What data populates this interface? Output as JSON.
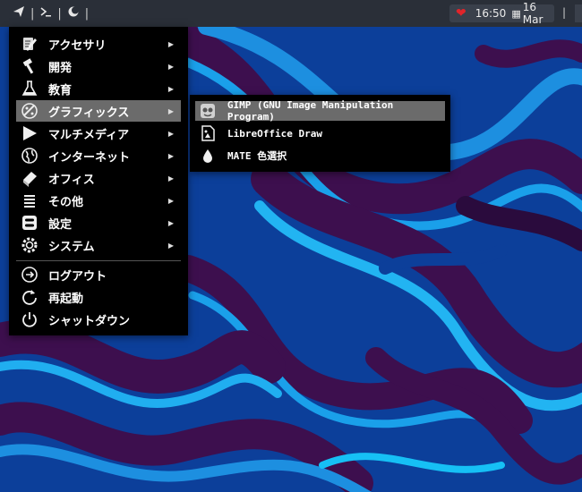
{
  "panel": {
    "icons": [
      "paper-plane-icon",
      "terminal-icon",
      "moon-icon"
    ],
    "separator": "|",
    "clock": {
      "time": "16:50",
      "date": "16 Mar"
    }
  },
  "menu": {
    "items": [
      {
        "label": "アクセサリ",
        "icon": "accessories-icon"
      },
      {
        "label": "開発",
        "icon": "hammer-icon"
      },
      {
        "label": "教育",
        "icon": "flask-icon"
      },
      {
        "label": "グラフィックス",
        "icon": "graphics-icon"
      },
      {
        "label": "マルチメディア",
        "icon": "play-icon"
      },
      {
        "label": "インターネット",
        "icon": "globe-icon"
      },
      {
        "label": "オフィス",
        "icon": "book-icon"
      },
      {
        "label": "その他",
        "icon": "list-icon"
      },
      {
        "label": "設定",
        "icon": "settings-icon"
      },
      {
        "label": "システム",
        "icon": "gear-icon"
      }
    ],
    "actions": [
      {
        "label": "ログアウト",
        "icon": "logout-icon"
      },
      {
        "label": "再起動",
        "icon": "restart-icon"
      },
      {
        "label": "シャットダウン",
        "icon": "power-icon"
      }
    ],
    "arrow": "▶"
  },
  "submenu": {
    "items": [
      {
        "label": "GIMP (GNU Image Manipulation Program)",
        "icon": "gimp-icon"
      },
      {
        "label": "LibreOffice Draw",
        "icon": "draw-icon"
      },
      {
        "label": "MATE 色選択",
        "icon": "droplet-icon"
      }
    ]
  },
  "colors": {
    "panel": "#2a2f38",
    "menu_bg": "#000000",
    "highlight": "#6b6b6b",
    "heart": "#e0242a"
  }
}
